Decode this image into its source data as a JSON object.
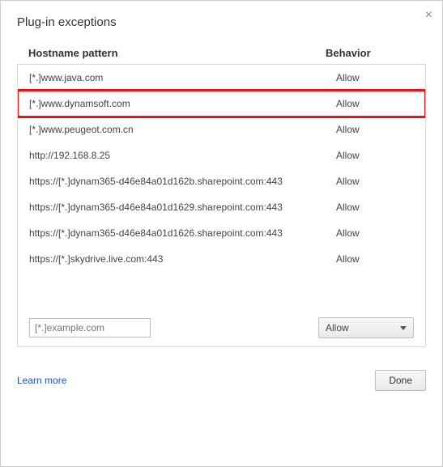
{
  "dialog": {
    "title": "Plug-in exceptions"
  },
  "columns": {
    "hostname": "Hostname pattern",
    "behavior": "Behavior"
  },
  "rows": [
    {
      "pattern": "[*.]www.java.com",
      "behavior": "Allow",
      "highlight": false
    },
    {
      "pattern": "[*.]www.dynamsoft.com",
      "behavior": "Allow",
      "highlight": true
    },
    {
      "pattern": "[*.]www.peugeot.com.cn",
      "behavior": "Allow",
      "highlight": false
    },
    {
      "pattern": "http://192.168.8.25",
      "behavior": "Allow",
      "highlight": false
    },
    {
      "pattern": "https://[*.]dynam365-d46e84a01d162b.sharepoint.com:443",
      "behavior": "Allow",
      "highlight": false
    },
    {
      "pattern": "https://[*.]dynam365-d46e84a01d1629.sharepoint.com:443",
      "behavior": "Allow",
      "highlight": false
    },
    {
      "pattern": "https://[*.]dynam365-d46e84a01d1626.sharepoint.com:443",
      "behavior": "Allow",
      "highlight": false
    },
    {
      "pattern": "https://[*.]skydrive.live.com:443",
      "behavior": "Allow",
      "highlight": false
    }
  ],
  "add": {
    "placeholder": "[*.]example.com",
    "behavior_selected": "Allow"
  },
  "footer": {
    "learn_more": "Learn more",
    "done": "Done"
  }
}
